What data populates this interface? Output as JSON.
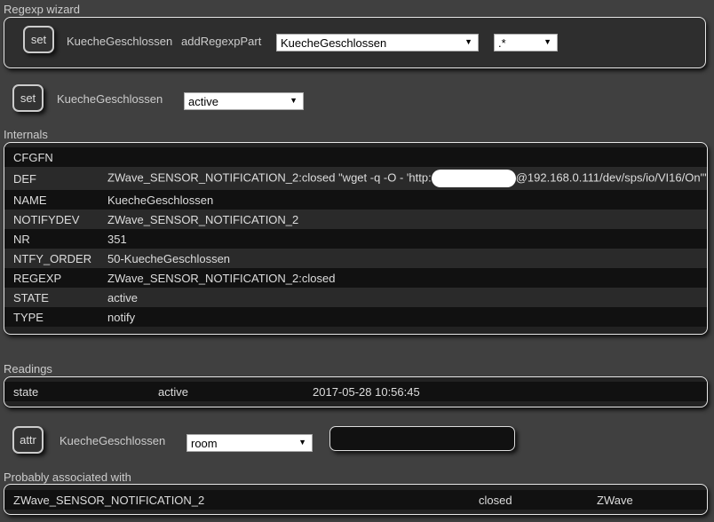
{
  "regexp_wizard": {
    "title": "Regexp wizard",
    "set_label": "set",
    "device": "KuecheGeschlossen",
    "command": "addRegexpPart",
    "select1": "KuecheGeschlossen",
    "select2": ".*"
  },
  "set_row": {
    "set_label": "set",
    "device": "KuecheGeschlossen",
    "select": "active"
  },
  "internals": {
    "title": "Internals",
    "rows": [
      {
        "k": "CFGFN",
        "v": ""
      },
      {
        "k": "DEF",
        "v1": "ZWave_SENSOR_NOTIFICATION_2:closed \"wget -q -O - 'http:",
        "v2": "@192.168.0.111/dev/sps/io/VI16/On'\""
      },
      {
        "k": "NAME",
        "v": "KuecheGeschlossen"
      },
      {
        "k": "NOTIFYDEV",
        "v": "ZWave_SENSOR_NOTIFICATION_2"
      },
      {
        "k": "NR",
        "v": "351"
      },
      {
        "k": "NTFY_ORDER",
        "v": "50-KuecheGeschlossen"
      },
      {
        "k": "REGEXP",
        "v": "ZWave_SENSOR_NOTIFICATION_2:closed"
      },
      {
        "k": "STATE",
        "v": "active"
      },
      {
        "k": "TYPE",
        "v": "notify"
      }
    ]
  },
  "readings": {
    "title": "Readings",
    "name": "state",
    "value": "active",
    "time": "2017-05-28 10:56:45"
  },
  "attr_row": {
    "attr_label": "attr",
    "device": "KuecheGeschlossen",
    "select": "room",
    "input_value": ""
  },
  "associated": {
    "title": "Probably associated with",
    "name": "ZWave_SENSOR_NOTIFICATION_2",
    "state": "closed",
    "type": "ZWave"
  }
}
